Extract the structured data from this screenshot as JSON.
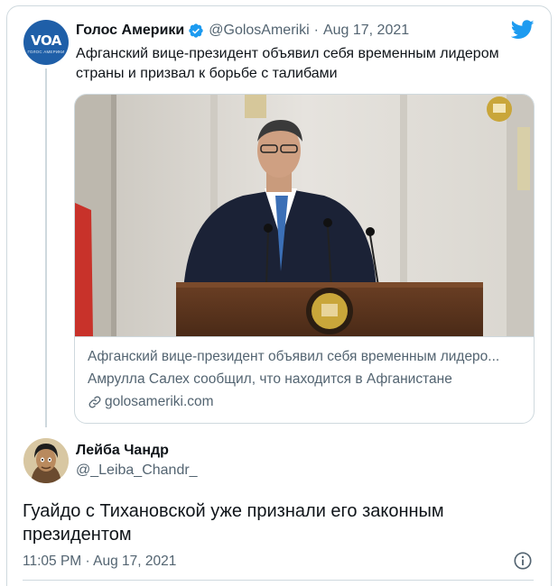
{
  "quoted_tweet": {
    "avatar_text": "VOA",
    "avatar_subtext": "ГОЛОС АМЕРИКИ",
    "display_name": "Голос Америки",
    "handle": "@GolosAmeriki",
    "separator": "·",
    "date": "Aug 17, 2021",
    "text": "Афганский вице-президент объявил себя временным лидером страны и призвал к борьбе с талибами",
    "verified": true,
    "card": {
      "title": "Афганский вице-президент объявил себя временным лидеро...",
      "description": "Амрулла Салех сообщил, что находится в Афганистане",
      "domain": "golosameriki.com"
    }
  },
  "main_tweet": {
    "display_name": "Лейба Чандр",
    "handle": "@_Leiba_Chandr_",
    "text": "Гуайдо с Тихановской уже признали его законным президентом",
    "timestamp": "11:05 PM · Aug 17, 2021"
  },
  "icons": {
    "brand": "twitter-bird-icon",
    "verified": "verified-badge-icon",
    "link": "link-icon",
    "info": "info-icon"
  },
  "colors": {
    "twitter_blue": "#1d9bf0",
    "secondary_text": "#536471",
    "border": "#cfd9de",
    "voa_blue": "#1f5fa8"
  }
}
